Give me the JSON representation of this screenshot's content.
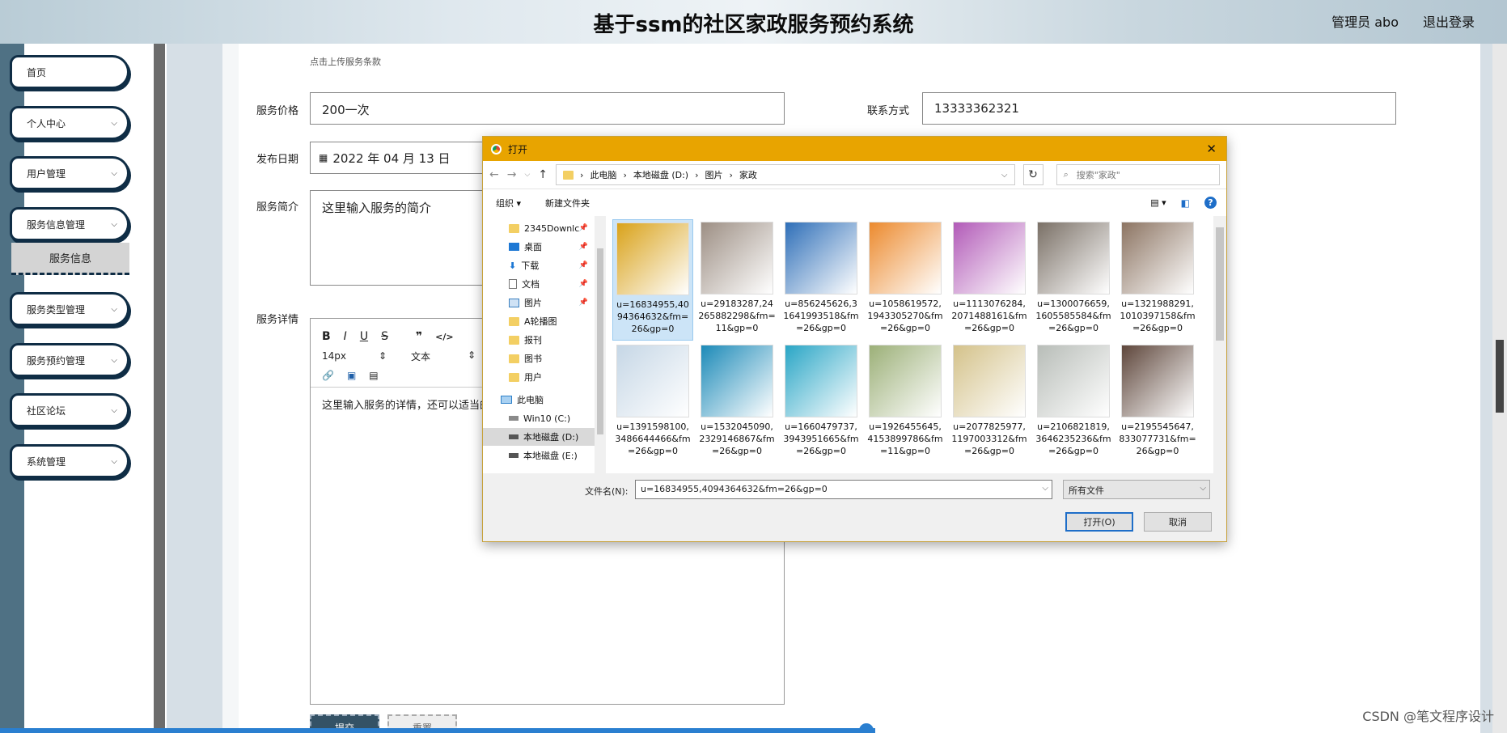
{
  "header": {
    "title": "基于ssm的社区家政服务预约系统",
    "admin": "管理员 abo",
    "logout": "退出登录"
  },
  "sidebar": {
    "items": [
      {
        "label": "首页"
      },
      {
        "label": "个人中心"
      },
      {
        "label": "用户管理"
      },
      {
        "label": "服务信息管理"
      },
      {
        "label": "服务类型管理"
      },
      {
        "label": "服务预约管理"
      },
      {
        "label": "社区论坛"
      },
      {
        "label": "系统管理"
      }
    ],
    "sub_item": "服务信息"
  },
  "form": {
    "upload_hint": "点击上传服务条款",
    "price_label": "服务价格",
    "price_value": "200一次",
    "contact_label": "联系方式",
    "contact_value": "13333362321",
    "date_label": "发布日期",
    "date_value": "2022 年 04 月 13 日",
    "intro_label": "服务简介",
    "intro_value": "这里输入服务的简介",
    "detail_label": "服务详情",
    "editor_fontsize": "14px",
    "editor_format": "文本",
    "editor_text": "这里输入服务的详情，还可以适当的",
    "submit": "提交",
    "reset": "重置"
  },
  "dialog": {
    "title": "打开",
    "path": [
      "此电脑",
      "本地磁盘 (D:)",
      "图片",
      "家政"
    ],
    "search_placeholder": "搜索\"家政\"",
    "organize": "组织",
    "new_folder": "新建文件夹",
    "tree": [
      {
        "label": "2345Downlc",
        "type": "folder",
        "pinned": true
      },
      {
        "label": "桌面",
        "type": "desktop",
        "pinned": true
      },
      {
        "label": "下载",
        "type": "download",
        "pinned": true
      },
      {
        "label": "文档",
        "type": "doc",
        "pinned": true
      },
      {
        "label": "图片",
        "type": "pic",
        "pinned": true
      },
      {
        "label": "A轮播图",
        "type": "folder",
        "pinned": false
      },
      {
        "label": "报刊",
        "type": "folder",
        "pinned": false
      },
      {
        "label": "图书",
        "type": "folder",
        "pinned": false
      },
      {
        "label": "用户",
        "type": "folder",
        "pinned": false
      },
      {
        "label": "此电脑",
        "type": "pc",
        "pinned": false
      },
      {
        "label": "Win10 (C:)",
        "type": "drive",
        "pinned": false
      },
      {
        "label": "本地磁盘 (D:)",
        "type": "drive",
        "pinned": false
      },
      {
        "label": "本地磁盘 (E:)",
        "type": "drive",
        "pinned": false
      }
    ],
    "files": [
      {
        "name": "u=16834955,4094364632&fm=26&gp=0",
        "color": "#d9a21a"
      },
      {
        "name": "u=29183287,24265882298&fm=11&gp=0",
        "color": "#9d8f84"
      },
      {
        "name": "u=856245626,31641993518&fm=26&gp=0",
        "color": "#2f6fb8"
      },
      {
        "name": "u=1058619572,1943305270&fm=26&gp=0",
        "color": "#ec8a2e"
      },
      {
        "name": "u=1113076284,2071488161&fm=26&gp=0",
        "color": "#b25bb8"
      },
      {
        "name": "u=1300076659,1605585584&fm=26&gp=0",
        "color": "#7a7066"
      },
      {
        "name": "u=1321988291,1010397158&fm=26&gp=0",
        "color": "#8c7462"
      },
      {
        "name": "u=1391598100,3486644466&fm=26&gp=0",
        "color": "#c6d7e6"
      },
      {
        "name": "u=1532045090,2329146867&fm=26&gp=0",
        "color": "#1c8ab8"
      },
      {
        "name": "u=1660479737,3943951665&fm=26&gp=0",
        "color": "#2aa6c6"
      },
      {
        "name": "u=1926455645,4153899786&fm=11&gp=0",
        "color": "#9cb078"
      },
      {
        "name": "u=2077825977,1197003312&fm=26&gp=0",
        "color": "#d4c28a"
      },
      {
        "name": "u=2106821819,3646235236&fm=26&gp=0",
        "color": "#b8bdb8"
      },
      {
        "name": "u=2195545647,833077731&fm=26&gp=0",
        "color": "#5e463b"
      }
    ],
    "filename_label": "文件名(N):",
    "filename_value": "u=16834955,4094364632&fm=26&gp=0",
    "filetype": "所有文件",
    "open_btn": "打开(O)",
    "cancel_btn": "取消"
  },
  "watermark": "CSDN @笔文程序设计"
}
